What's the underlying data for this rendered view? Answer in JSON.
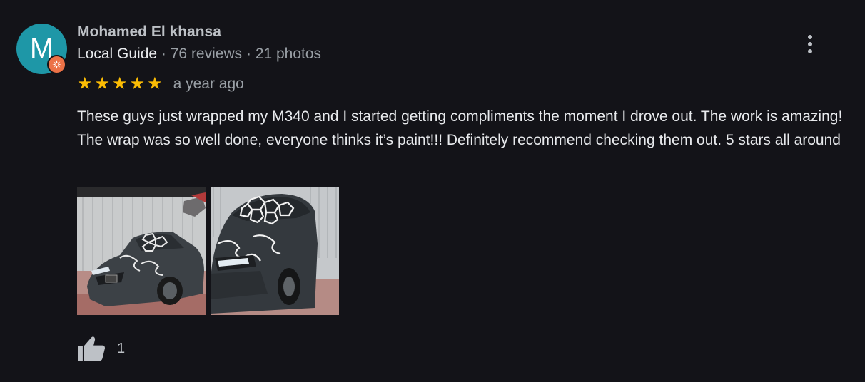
{
  "review": {
    "author": {
      "initial": "M",
      "name": "Mohamed El khansa",
      "badge_icon": "local-guide-badge-icon",
      "guide_label": "Local Guide",
      "reviews": "76 reviews",
      "photos": "21 photos",
      "avatar_color": "#1e97a7",
      "badge_color": "#ec7247"
    },
    "rating": 5,
    "rating_max": 5,
    "time_ago": "a year ago",
    "text": "These guys just wrapped my M340 and I started getting compliments the moment I drove out. The work is amazing! The wrap was so well done, everyone thinks it’s paint!!! Definitely recommend checking them out. 5 stars all around",
    "photos_count": 2,
    "like_icon": "thumbs-up-icon",
    "like_count": "1",
    "more_icon": "more-vert-icon"
  },
  "colors": {
    "background": "#131318",
    "star": "#fbbc04",
    "text_primary": "#e8eaed",
    "text_secondary": "#9aa0a6"
  }
}
